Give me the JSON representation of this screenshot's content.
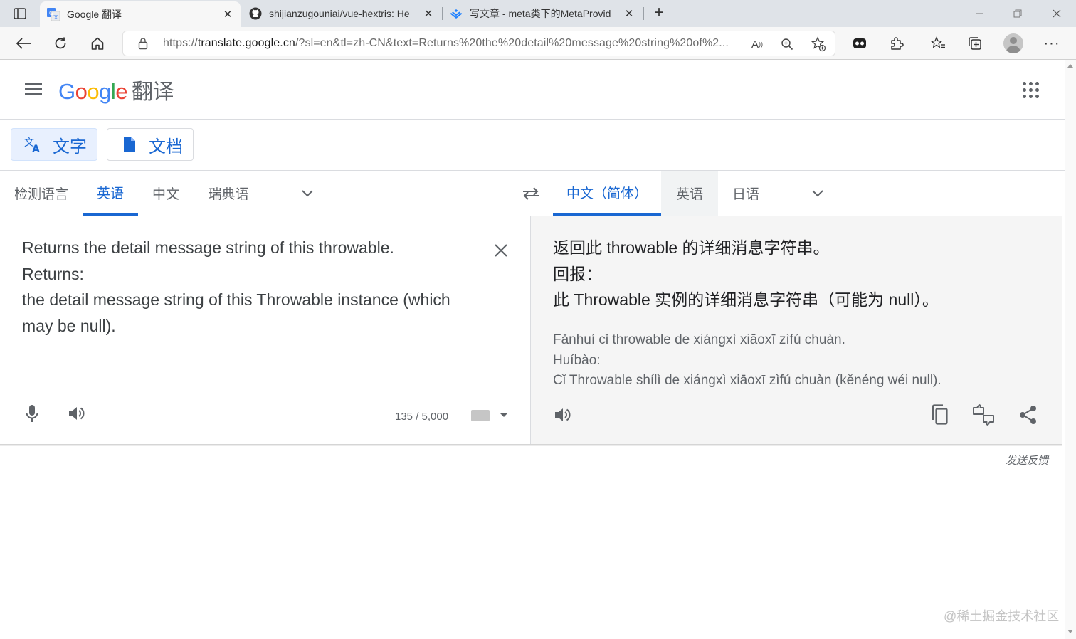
{
  "browser": {
    "tabs": [
      {
        "title": "Google 翻译",
        "favicon": "google-translate-icon",
        "active": true
      },
      {
        "title": "shijianzugouniai/vue-hextris: He",
        "favicon": "github-icon",
        "active": false
      },
      {
        "title": "写文章 - meta类下的MetaProvid",
        "favicon": "juejin-icon",
        "active": false
      }
    ],
    "new_tab_label": "+",
    "address": {
      "prefix": "https://",
      "domain": "translate.google.cn",
      "rest": "/?sl=en&tl=zh-CN&text=Returns%20the%20detail%20message%20string%20of%2..."
    }
  },
  "header": {
    "logo": {
      "g1": "G",
      "o1": "o",
      "o2": "o",
      "g2": "g",
      "l": "l",
      "e": "e"
    },
    "product": "翻译"
  },
  "modes": {
    "text_label": "文字",
    "docs_label": "文档"
  },
  "source_langs": {
    "detect": "检测语言",
    "items": [
      "英语",
      "中文",
      "瑞典语"
    ],
    "selected": "英语"
  },
  "target_langs": {
    "items": [
      "中文（简体）",
      "英语",
      "日语"
    ],
    "selected": "中文（简体）"
  },
  "source": {
    "lines": [
      "Returns the detail message string of this throwable.",
      "Returns:",
      "the detail message string of this Throwable instance (which may be null)."
    ],
    "char_count": "135 / 5,000"
  },
  "target": {
    "lines": [
      "返回此 throwable 的详细消息字符串。",
      "回报：",
      "此 Throwable 实例的详细消息字符串（可能为 null）。"
    ],
    "translit": [
      "Fǎnhuí cǐ throwable de xiángxì xiāoxī zìfú chuàn.",
      "Huíbào:",
      "Cǐ Throwable shílì de xiángxì xiāoxī zìfú chuàn (kěnéng wéi null)."
    ]
  },
  "feedback_label": "发送反馈",
  "watermark": "@稀土掘金技术社区",
  "colors": {
    "accent": "#1967d2",
    "selected_bg": "#e8f0fe",
    "target_bg": "#f5f5f5"
  }
}
